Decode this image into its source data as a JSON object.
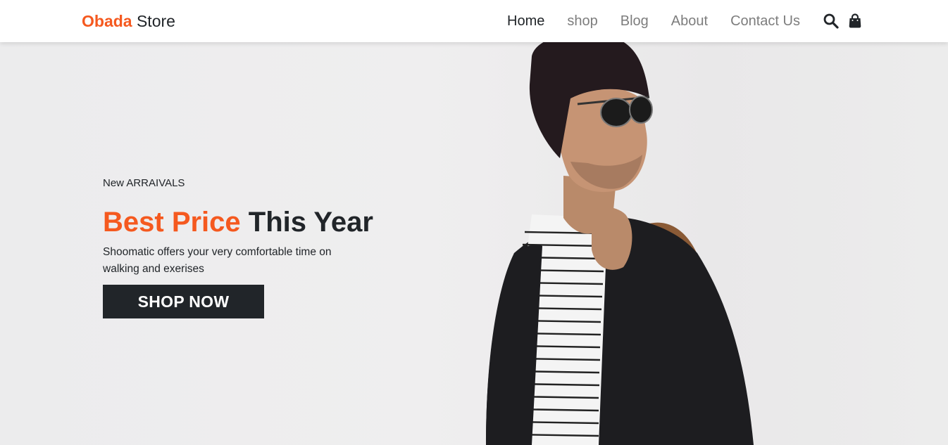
{
  "brand": {
    "accent": "Obada",
    "rest": " Store"
  },
  "nav": {
    "links": [
      {
        "label": "Home",
        "active": true
      },
      {
        "label": "shop",
        "active": false
      },
      {
        "label": "Blog",
        "active": false
      },
      {
        "label": "About",
        "active": false
      },
      {
        "label": "Contact Us",
        "active": false
      }
    ],
    "icons": [
      "search-icon",
      "shopping-bag-icon"
    ]
  },
  "hero": {
    "eyebrow": "New ARRAIVALS",
    "headline_accent": "Best Price",
    "headline_rest": " This Year",
    "subtitle": "Shoomatic offers your very comfortable time on walking and exerises",
    "cta_label": "SHOP NOW",
    "image": "man-with-sunglasses-beanie-and-leather-bag"
  },
  "colors": {
    "accent": "#f5591f",
    "dark": "#212529",
    "muted": "#7d7d7d",
    "background": "#efeeee"
  }
}
